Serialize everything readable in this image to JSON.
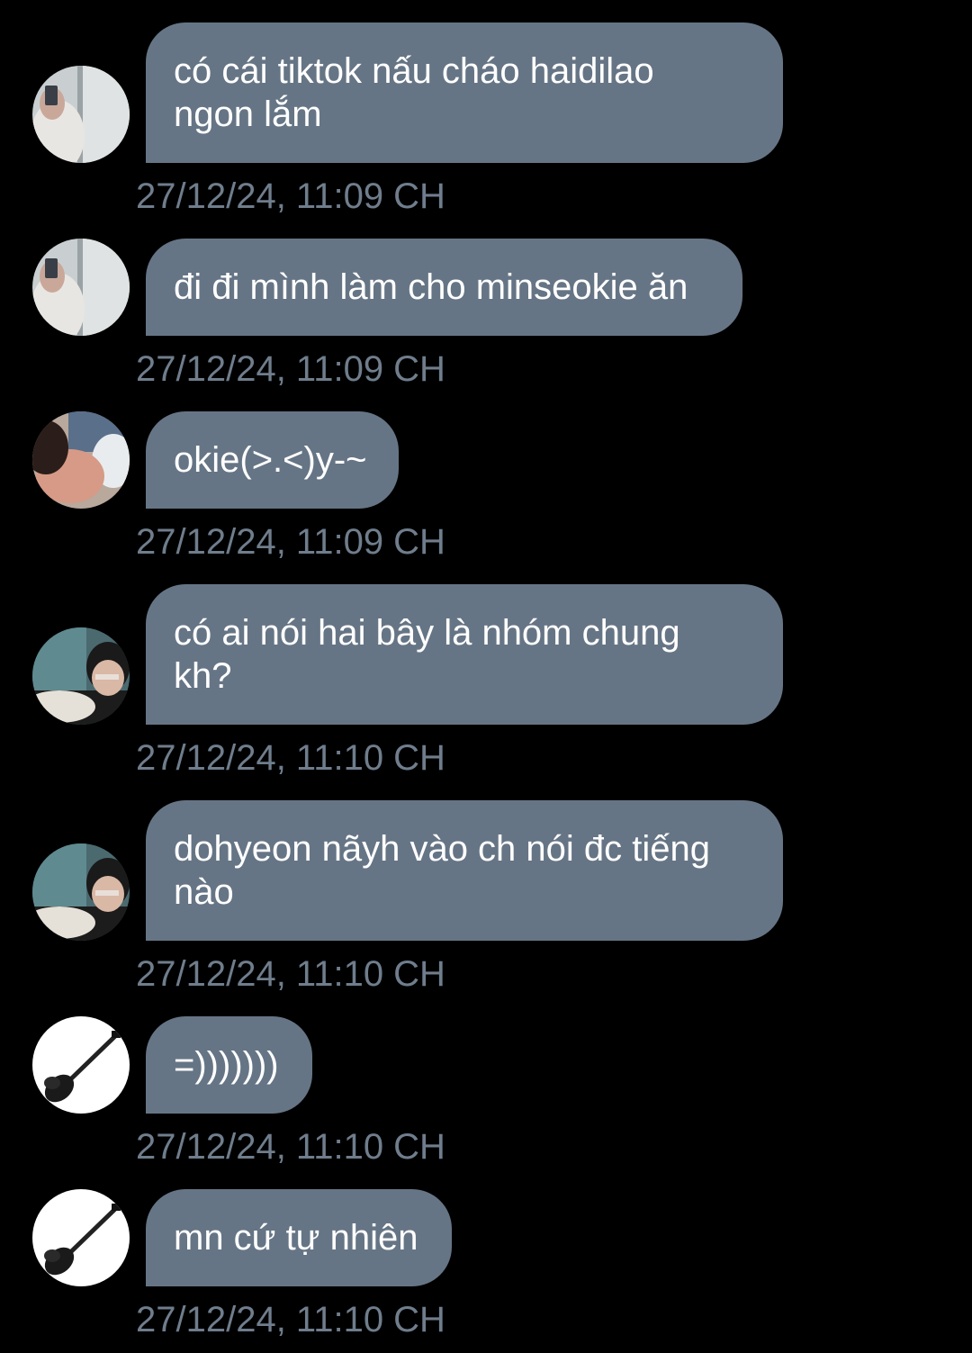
{
  "theme": {
    "background": "#000000",
    "bubble_color": "#667585",
    "bubble_text_color": "#ffffff",
    "timestamp_color": "#6f7d8c"
  },
  "messages": [
    {
      "avatar": "avatar-selfie-mirror",
      "text": "có cái tiktok nấu cháo haidilao\nngon lắm",
      "time": "27/12/24, 11:09 CH"
    },
    {
      "avatar": "avatar-selfie-mirror",
      "text": "đi đi mình làm cho minseokie ăn",
      "time": "27/12/24, 11:09 CH"
    },
    {
      "avatar": "avatar-sleeping-face",
      "text": "okie(>.<)y-~",
      "time": "27/12/24, 11:09 CH"
    },
    {
      "avatar": "avatar-glasses-person",
      "text": "có ai nói hai bây là nhóm chung\nkh?",
      "time": "27/12/24, 11:10 CH"
    },
    {
      "avatar": "avatar-glasses-person",
      "text": "dohyeon nãyh vào ch nói đc tiếng\nnào",
      "time": "27/12/24, 11:10 CH"
    },
    {
      "avatar": "avatar-guitar",
      "text": "=)))))))",
      "time": "27/12/24, 11:10 CH"
    },
    {
      "avatar": "avatar-guitar",
      "text": "mn cứ tự nhiên",
      "time": "27/12/24, 11:10 CH"
    }
  ]
}
